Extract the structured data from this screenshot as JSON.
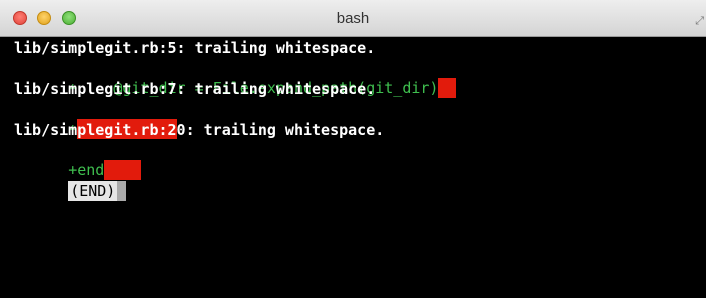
{
  "window": {
    "title": "bash"
  },
  "terminal": {
    "lines": [
      {
        "text": "lib/simplegit.rb:5: trailing whitespace."
      },
      {
        "text": "+    @git_dir = File.expand_path(git_dir)"
      },
      {
        "text": "lib/simplegit.rb:7: trailing whitespace."
      },
      {
        "text": "+"
      },
      {
        "text": "lib/simplegit.rb:20: trailing whitespace."
      },
      {
        "text": "+end"
      },
      {
        "text": "(END)"
      }
    ]
  },
  "colors": {
    "background": "#000000",
    "text": "#ffffff",
    "added_line": "#3fbf4f",
    "whitespace_highlight": "#e21b0c",
    "pager_prompt_bg": "#e6e6e6"
  },
  "icons": {
    "close": "close-button",
    "minimize": "minimize-button",
    "zoom": "zoom-button",
    "fullscreen": "fullscreen-icon"
  }
}
